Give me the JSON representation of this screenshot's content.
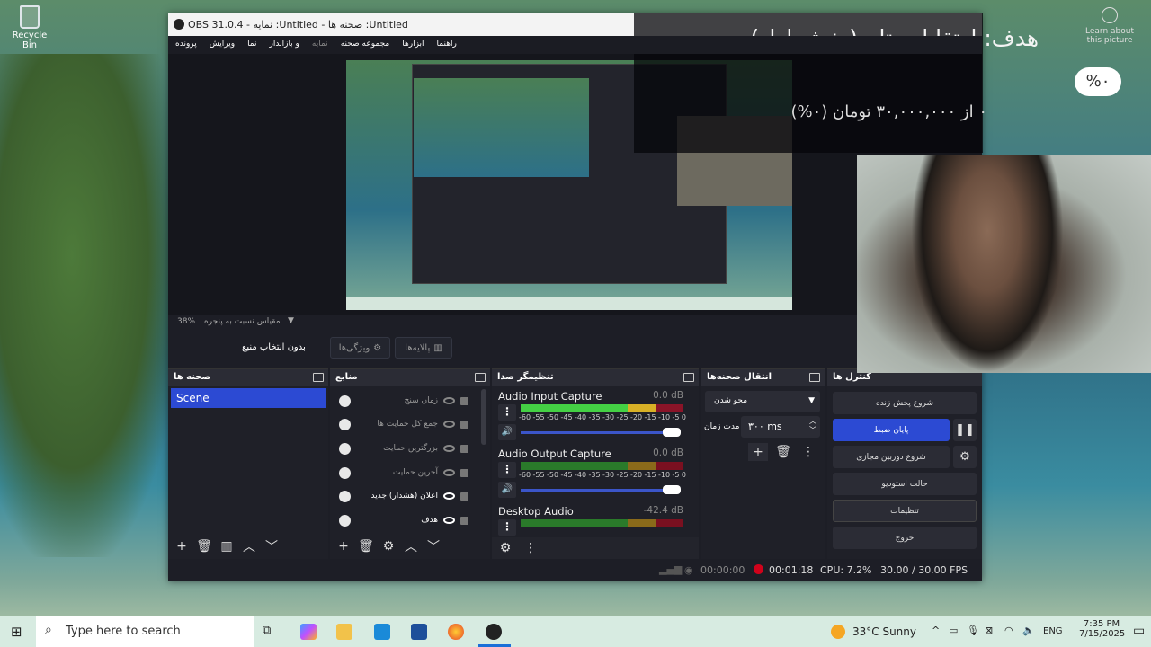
{
  "desktop": {
    "recycle_bin": "Recycle Bin"
  },
  "window": {
    "title": "OBS 31.0.4 - نمایه :Untitled - صحنه ها :Untitled"
  },
  "menu": [
    {
      "label": "پرونده"
    },
    {
      "label": "ویرایش"
    },
    {
      "label": "نما"
    },
    {
      "label": "و بازانداز"
    },
    {
      "label": "نمایه",
      "disabled": true
    },
    {
      "label": "مجموعه صحنه"
    },
    {
      "label": "ابزارها"
    },
    {
      "label": "راهنما"
    }
  ],
  "zoom": {
    "percent": "38%",
    "mode": "مقیاس نسبت به پنجره"
  },
  "toolbar": {
    "no_source": "بدون انتخاب منبع",
    "properties": "ویژگی‌ها",
    "filters": "پالایه‌ها"
  },
  "scenes": {
    "title": "صحنه ها",
    "items": [
      "Scene"
    ]
  },
  "sources": {
    "title": "منابع",
    "items": [
      {
        "name": "زمان سنج",
        "visible": false
      },
      {
        "name": "جمع کل حمایت ها",
        "visible": false
      },
      {
        "name": "بزرگترین حمایت",
        "visible": false
      },
      {
        "name": "آخرین حمایت",
        "visible": false
      },
      {
        "name": "اعلان (هشدار) جدید",
        "visible": true
      },
      {
        "name": "هدف",
        "visible": true
      }
    ]
  },
  "mixer": {
    "title": "تنظیمگر صدا",
    "scale": [
      "-60",
      "-55",
      "-50",
      "-45",
      "-40",
      "-35",
      "-30",
      "-25",
      "-20",
      "-15",
      "-10",
      "-5",
      "0"
    ],
    "channels": [
      {
        "name": "Audio Input Capture",
        "db": "0.0 dB",
        "level": 0.72,
        "volume": 1.0
      },
      {
        "name": "Audio Output Capture",
        "db": "0.0 dB",
        "level": 0,
        "volume": 1.0
      },
      {
        "name": "Desktop Audio",
        "db": "-42.4 dB",
        "level": 0,
        "volume": 1.0
      }
    ]
  },
  "transitions": {
    "title": "انتقال صحنه‌ها",
    "selected": "محو شدن",
    "duration_label": "مدت زمان",
    "duration": "۳۰۰ ms"
  },
  "controls": {
    "title": "کنترل ها",
    "start_stream": "شروع پخش زنده",
    "stop_record": "پایان ضبط",
    "virtual_cam": "شروع دوربین مجازی",
    "studio_mode": "حالت استودیو",
    "settings": "تنظیمات",
    "exit": "خروج"
  },
  "status": {
    "stream_time": "00:00:00",
    "record_time": "00:01:18",
    "cpu": "CPU: 7.2%",
    "fps": "30.00 / 30.00 FPS"
  },
  "overlay": {
    "goal": "هدف: ارتقا لپ تاپ(بخش اول)",
    "percent": "%۰",
    "progress": "۰ از ۳۰,۰۰۰,۰۰۰ تومان (۰%)",
    "learn": "Learn about this picture"
  },
  "taskbar": {
    "search_placeholder": "Type here to search",
    "weather": "33°C  Sunny",
    "lang": "ENG",
    "time": "7:35 PM",
    "date": "7/15/2025"
  },
  "colors": {
    "accent": "#2c4ad3",
    "record": "#d0021b"
  }
}
